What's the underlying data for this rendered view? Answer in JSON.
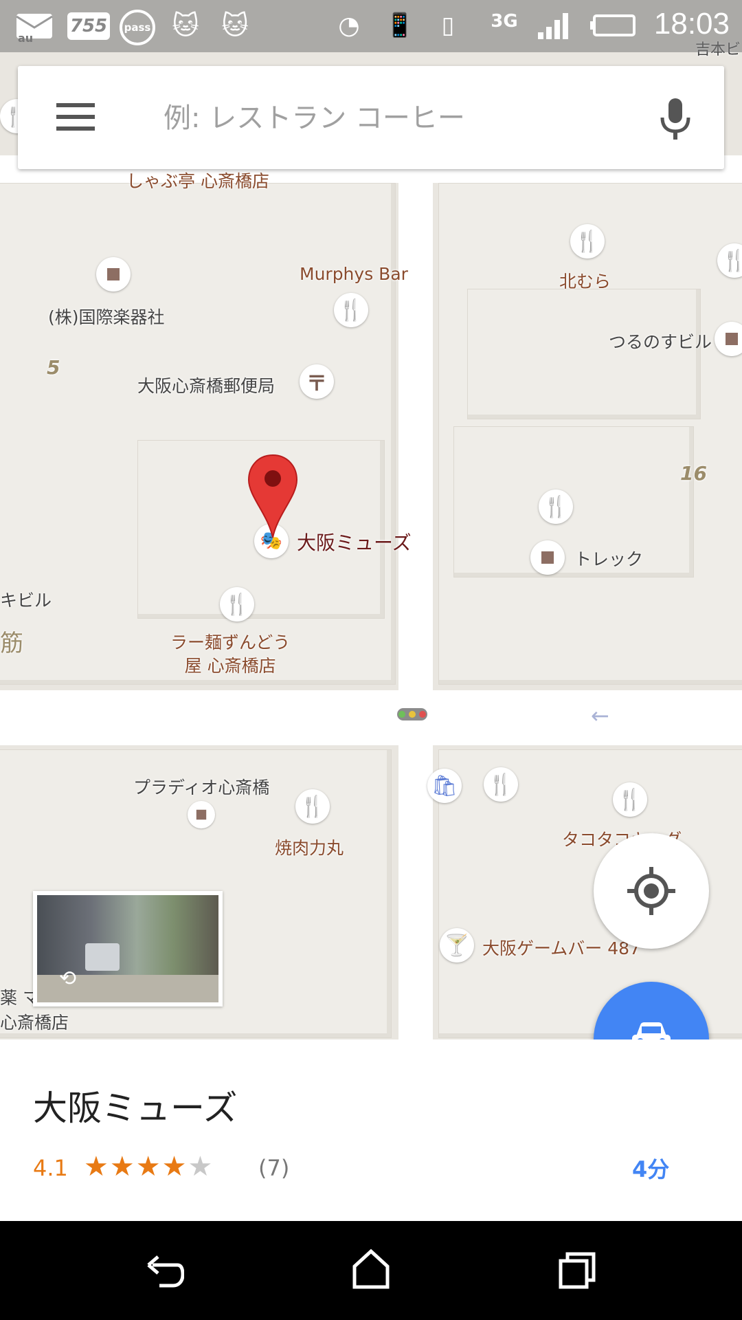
{
  "status_bar": {
    "time": "18:03",
    "notification_icons": [
      "au",
      "755",
      "pass"
    ],
    "network_type": "3G",
    "colors": {
      "background": "#7a7a7a",
      "icon": "#ffffff"
    }
  },
  "search": {
    "placeholder": "例: レストラン コーヒー",
    "value": ""
  },
  "map": {
    "top_right_label": "吉本ビ",
    "labels": {
      "shabu": "しゃぶ亭 心斎橋店",
      "murphys": "Murphys Bar",
      "kokusai": "(株)国際楽器社",
      "kitamura": "北むら",
      "tsurunosu": "つるのすビル",
      "num5": "5",
      "post_office": "大阪心斎橋郵便局",
      "num16": "16",
      "osaka_muse": "大阪ミューズ",
      "trek": "トレック",
      "left_building": "キビル",
      "suji": "筋",
      "ramen": "ラー麺ずんどう\n屋 心斎橋店",
      "pradio": "プラディオ心斎橋",
      "yakiniku": "焼肉力丸",
      "takota": "タコタコキング",
      "gamebar": "大阪ゲームバー 487",
      "left_bottom_1": "薬 マ",
      "left_bottom_2": "心斎橋店"
    },
    "colors": {
      "accent_poi": "#ef8a1a",
      "pin": "#e53935",
      "road": "#ffffff",
      "background": "#e9e6e0"
    }
  },
  "place": {
    "name": "大阪ミューズ",
    "rating": "4.1",
    "stars_filled": 4,
    "stars_total": 5,
    "reviews": "(7)",
    "travel_time": "4分"
  },
  "icons": {
    "menu": "menu-icon",
    "mic": "mic-icon",
    "locate": "my-location-icon",
    "car": "car-icon",
    "back": "back-icon",
    "home": "home-icon",
    "recents": "recents-icon"
  }
}
